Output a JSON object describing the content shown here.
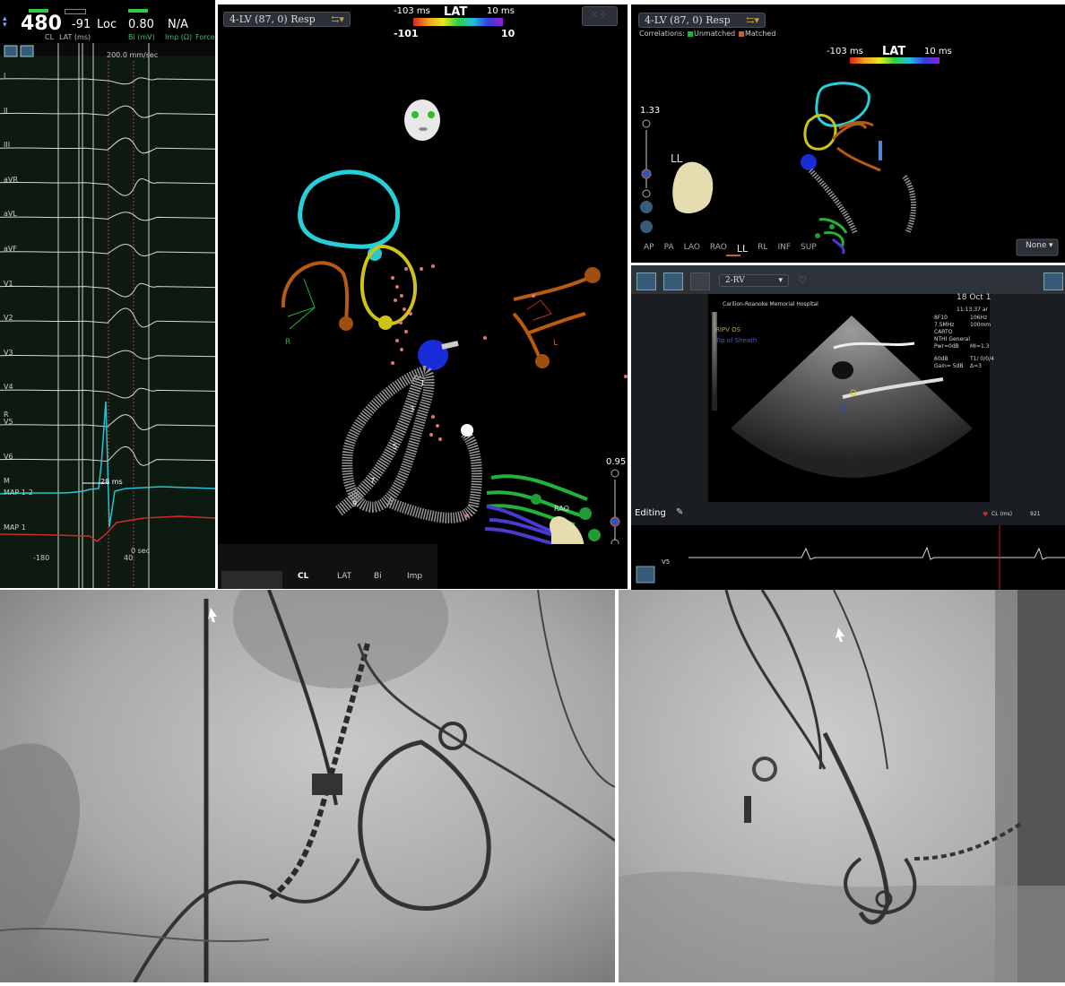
{
  "ecg_panel": {
    "cl_value": "480",
    "cl_label": "CL",
    "lat_value": "-91",
    "lat_label": "LAT (ms)",
    "loc_value": "Loc",
    "bi_value": "0.80",
    "bi_label": "Bi (mV)",
    "imp_value": "N/A",
    "imp_label": "Imp (Ω)",
    "force_label": "Force",
    "sweep_speed": "200.0 mm/sec",
    "leads": [
      "I",
      "II",
      "III",
      "aVR",
      "aVL",
      "aVF",
      "V1",
      "V2",
      "V3",
      "V4",
      "V5",
      "V6"
    ],
    "map_leads": [
      "M",
      "MAP 1-2",
      "MAP 1"
    ],
    "interval_label": "28 ms",
    "axis_left": "-180",
    "axis_right": "40",
    "axis_zero": "0 sec",
    "r_label": "R"
  },
  "main_map": {
    "view_title": "4-LV (87, 0) Resp",
    "lat_title": "LAT",
    "lat_min": "-103 ms",
    "lat_max": "10 ms",
    "range_low": "-101",
    "range_high": "10",
    "zoom_value": "0.95",
    "label_r": "R",
    "label_l": "L",
    "label_rao": "RAO",
    "catheter_numbers": [
      "1",
      "3",
      "5",
      "7",
      "9"
    ],
    "bottom_tabs": [
      "CL",
      "LAT",
      "Bi",
      "Imp"
    ]
  },
  "small_map": {
    "view_title": "4-LV (87, 0) Resp",
    "correlations_label": "Correlations:",
    "unmatched_label": "Unmatched",
    "matched_label": "Matched",
    "lat_title": "LAT",
    "lat_min": "-103 ms",
    "lat_max": "10 ms",
    "zoom_value": "1.33",
    "orientation_label": "LL",
    "views": [
      "AP",
      "PA",
      "LAO",
      "RAO",
      "LL",
      "RL",
      "INF",
      "SUP"
    ],
    "selected_view": "LL",
    "none_dropdown": "None"
  },
  "echo_panel": {
    "preset_dropdown": "2-RV",
    "hospital": "Carilion-Roanoke Memorial Hospital",
    "date": "18 Oct 1",
    "time": "11:13:37 ar",
    "params_left": [
      "8F10",
      "7.5MHz",
      "CARTO",
      "NTHI General",
      "Pwr=0dB",
      "60dB",
      "Gain= 5dB"
    ],
    "params_right": [
      "106Hz",
      "100mm",
      "MI=1.3",
      "T1/ 0/0/4",
      "Δ=3"
    ],
    "legend_1": "RIPV OS",
    "legend_2": "Tip of Sheath",
    "editing_label": "Editing",
    "cl_label": "CL (ms)",
    "cl_value": "921",
    "strip_lead": "V5"
  },
  "colors": {
    "map_cyan": "#27d0d8",
    "map_yellow": "#cfc31a",
    "map_orange": "#b85b12",
    "map_green": "#22b43a",
    "map_purple": "#4a3bd0",
    "ecg_trace": "#d8d8d8",
    "map_trace_cyan": "#25c4d4",
    "map_trace_red": "#d22a2a"
  }
}
